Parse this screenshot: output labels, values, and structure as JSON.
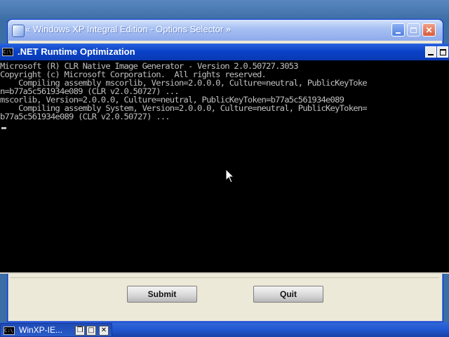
{
  "options_dialog": {
    "title": "« Windows XP Integral Edition - Options Selector »",
    "submit_label": "Submit",
    "quit_label": "Quit"
  },
  "console": {
    "title": ".NET Runtime Optimization",
    "lines": [
      "Microsoft (R) CLR Native Image Generator - Version 2.0.50727.3053",
      "Copyright (c) Microsoft Corporation.  All rights reserved.",
      "    Compiling assembly mscorlib, Version=2.0.0.0, Culture=neutral, PublicKeyToke",
      "n=b77a5c561934e089 (CLR v2.0.50727) ...",
      "mscorlib, Version=2.0.0.0, Culture=neutral, PublicKeyToken=b77a5c561934e089",
      "    Compiling assembly System, Version=2.0.0.0, Culture=neutral, PublicKeyToken=",
      "b77a5c561934e089 (CLR v2.0.50727) ..."
    ]
  },
  "taskbar": {
    "item_label": "WinXP-IE..."
  },
  "colors": {
    "console_background": "#000000",
    "console_text": "#c0c0c0",
    "console_titlebar": "#0a43c8",
    "dialog_face": "#ece9d8",
    "taskbar": "#2157d0"
  },
  "icons": [
    "cmd-icon",
    "minimize-icon",
    "maximize-icon",
    "close-icon",
    "mouse-pointer-icon"
  ]
}
